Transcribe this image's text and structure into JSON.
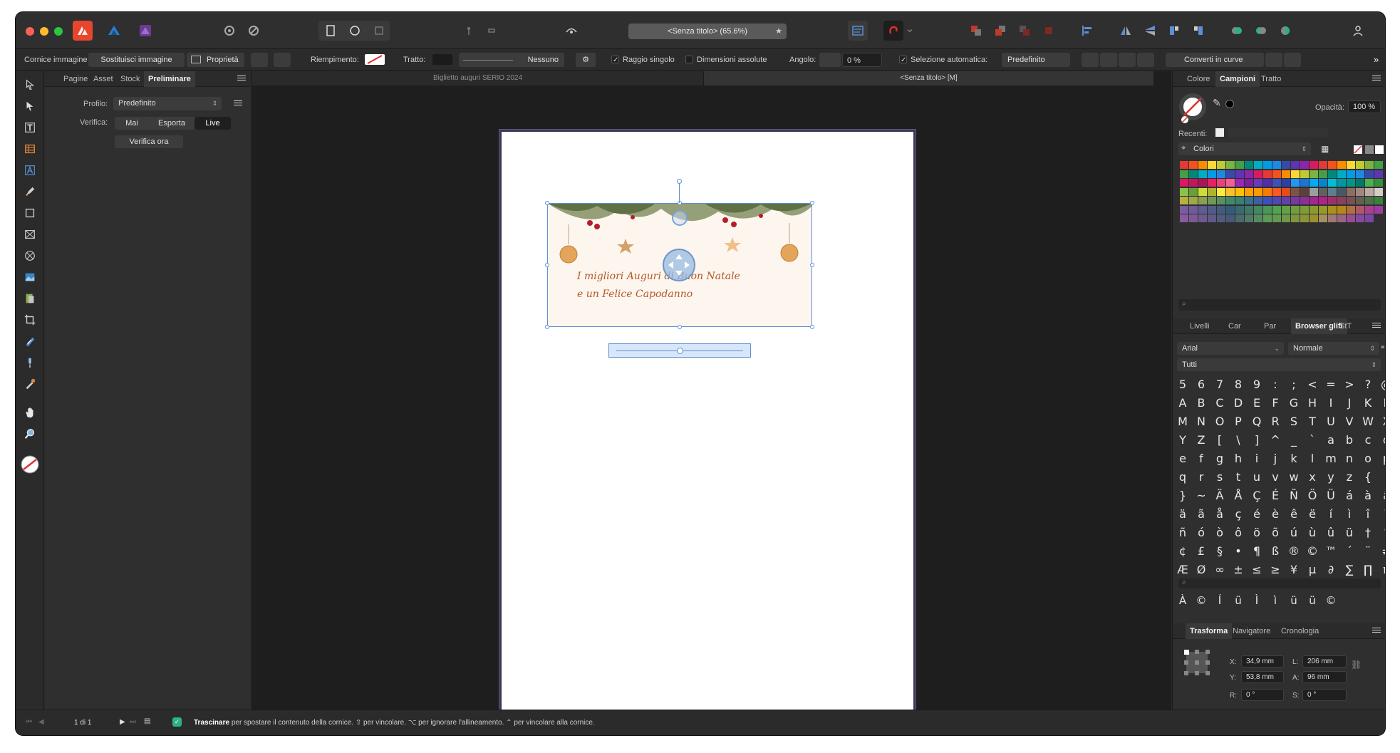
{
  "window": {
    "title": "<Senza titolo> (65.6%)"
  },
  "context_toolbar": {
    "frame_label": "Cornice immagine",
    "replace_image": "Sostituisci immagine",
    "properties": "Proprietà",
    "fill_label": "Riempimento:",
    "stroke_label": "Tratto:",
    "stroke_value": "Nessuno",
    "single_radius": "Raggio singolo",
    "absolute_sizes": "Dimensioni assolute",
    "angle_label": "Angolo:",
    "angle_value": "0 %",
    "auto_select": "Selezione automatica:",
    "auto_select_value": "Predefinito",
    "convert_curves": "Converti in curve"
  },
  "left_panel": {
    "tabs": [
      "Pagine",
      "Asset",
      "Stock",
      "Preliminare"
    ],
    "active_tab": 3,
    "profile_label": "Profilo:",
    "profile_value": "Predefinito",
    "verify_label": "Verifica:",
    "verify_options": [
      "Mai",
      "Esporta",
      "Live"
    ],
    "verify_selected": 2,
    "verify_now": "Verifica ora"
  },
  "document_tabs": [
    {
      "label": "Biglietto auguri SERIO 2024",
      "active": false
    },
    {
      "label": "<Senza titolo> [M]",
      "active": true
    }
  ],
  "card": {
    "line1": "I migliori Auguri di Buon Natale",
    "line2": "e un Felice Capodanno"
  },
  "right_top": {
    "tabs": [
      "Colore",
      "Campioni",
      "Tratto"
    ],
    "active_tab": 1,
    "opacity_label": "Opacità:",
    "opacity_value": "100 %",
    "recent_label": "Recenti:",
    "palette_value": "Colori"
  },
  "right_mid": {
    "tabs": [
      "Livelli",
      "Car",
      "Par",
      "Browser glifi",
      "StT"
    ],
    "active_tab": 3,
    "font": "Arial",
    "style": "Normale",
    "subset": "Tutti",
    "glyph_rows": [
      [
        "5",
        "6",
        "7",
        "8",
        "9",
        ":",
        ";",
        "<",
        "=",
        ">",
        "?",
        "@"
      ],
      [
        "A",
        "B",
        "C",
        "D",
        "E",
        "F",
        "G",
        "H",
        "I",
        "J",
        "K",
        "L"
      ],
      [
        "M",
        "N",
        "O",
        "P",
        "Q",
        "R",
        "S",
        "T",
        "U",
        "V",
        "W",
        "X"
      ],
      [
        "Y",
        "Z",
        "[",
        "\\",
        "]",
        "^",
        "_",
        "`",
        "a",
        "b",
        "c",
        "d"
      ],
      [
        "e",
        "f",
        "g",
        "h",
        "i",
        "j",
        "k",
        "l",
        "m",
        "n",
        "o",
        "p"
      ],
      [
        "q",
        "r",
        "s",
        "t",
        "u",
        "v",
        "w",
        "x",
        "y",
        "z",
        "{",
        "|"
      ],
      [
        "}",
        "~",
        "Ä",
        "Å",
        "Ç",
        "É",
        "Ñ",
        "Ö",
        "Ü",
        "á",
        "à",
        "â"
      ],
      [
        "ä",
        "ã",
        "å",
        "ç",
        "é",
        "è",
        "ê",
        "ë",
        "í",
        "ì",
        "î",
        "ï"
      ],
      [
        "ñ",
        "ó",
        "ò",
        "ô",
        "ö",
        "õ",
        "ú",
        "ù",
        "û",
        "ü",
        "†",
        "°"
      ],
      [
        "¢",
        "£",
        "§",
        "•",
        "¶",
        "ß",
        "®",
        "©",
        "™",
        "´",
        "¨",
        "≠"
      ],
      [
        "Æ",
        "Ø",
        "∞",
        "±",
        "≤",
        "≥",
        "¥",
        "µ",
        "∂",
        "∑",
        "∏",
        "π"
      ]
    ],
    "recent_glyphs": [
      "À",
      "©",
      "Í",
      "ü",
      "Ì",
      "ì",
      "ü",
      "ü",
      "©"
    ]
  },
  "right_bottom": {
    "tabs": [
      "Trasforma",
      "Navigatore",
      "Cronologia"
    ],
    "active_tab": 0,
    "x_label": "X:",
    "x_value": "34,9 mm",
    "y_label": "Y:",
    "y_value": "53,8 mm",
    "w_label": "L:",
    "w_value": "206 mm",
    "h_label": "A:",
    "h_value": "96 mm",
    "r_label": "R:",
    "r_value": "0 °",
    "s_label": "S:",
    "s_value": "0 °"
  },
  "status": {
    "page_info": "1 di 1",
    "hint_bold": "Trascinare",
    "hint_text": " per spostare il contenuto della cornice. ⇧ per vincolare. ⌥ per ignorare l'allineamento. ⌃ per vincolare alla cornice."
  },
  "colors": {
    "accent": "#5b8fd6",
    "panel": "#2f2f2f",
    "canvas": "#1e1e1e"
  }
}
